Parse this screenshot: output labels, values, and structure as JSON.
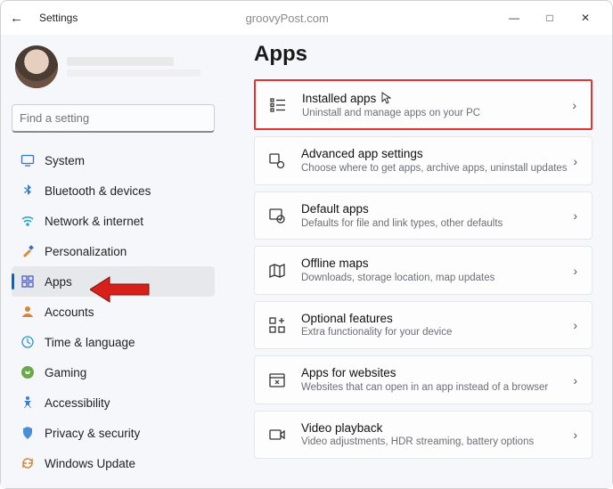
{
  "window": {
    "title": "Settings",
    "watermark": "groovyPost.com"
  },
  "search": {
    "placeholder": "Find a setting"
  },
  "sidebar": {
    "items": [
      {
        "label": "System"
      },
      {
        "label": "Bluetooth & devices"
      },
      {
        "label": "Network & internet"
      },
      {
        "label": "Personalization"
      },
      {
        "label": "Apps"
      },
      {
        "label": "Accounts"
      },
      {
        "label": "Time & language"
      },
      {
        "label": "Gaming"
      },
      {
        "label": "Accessibility"
      },
      {
        "label": "Privacy & security"
      },
      {
        "label": "Windows Update"
      }
    ]
  },
  "page": {
    "title": "Apps",
    "cards": [
      {
        "title": "Installed apps",
        "desc": "Uninstall and manage apps on your PC"
      },
      {
        "title": "Advanced app settings",
        "desc": "Choose where to get apps, archive apps, uninstall updates"
      },
      {
        "title": "Default apps",
        "desc": "Defaults for file and link types, other defaults"
      },
      {
        "title": "Offline maps",
        "desc": "Downloads, storage location, map updates"
      },
      {
        "title": "Optional features",
        "desc": "Extra functionality for your device"
      },
      {
        "title": "Apps for websites",
        "desc": "Websites that can open in an app instead of a browser"
      },
      {
        "title": "Video playback",
        "desc": "Video adjustments, HDR streaming, battery options"
      }
    ]
  }
}
